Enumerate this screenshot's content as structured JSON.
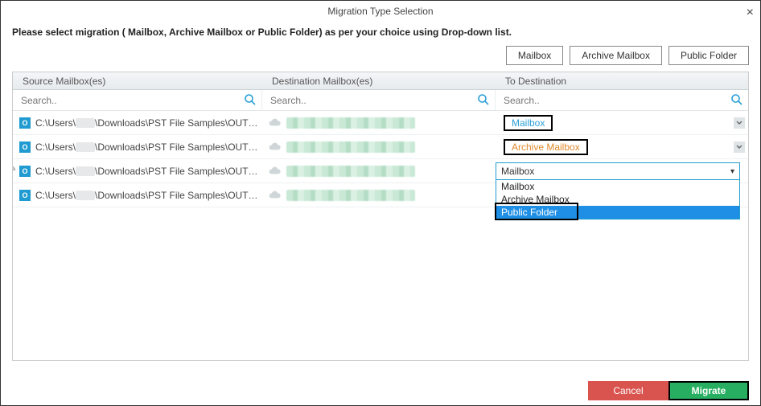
{
  "window": {
    "title": "Migration Type Selection",
    "subtitle": "Please select migration ( Mailbox, Archive Mailbox or Public Folder) as per your choice using Drop-down list."
  },
  "type_buttons": {
    "mailbox": "Mailbox",
    "archive": "Archive Mailbox",
    "public": "Public Folder"
  },
  "columns": {
    "source": "Source Mailbox(es)",
    "destination": "Destination Mailbox(es)",
    "to": "To Destination"
  },
  "search": {
    "placeholder": "Search.."
  },
  "rows": [
    {
      "prefix": "C:\\Users\\",
      "suffix": "\\Downloads\\PST File Samples\\OUTLOO...",
      "dest_label": "Mailbox",
      "dest_style": "blue"
    },
    {
      "prefix": "C:\\Users\\",
      "suffix": "\\Downloads\\PST File Samples\\OUTLOO...",
      "dest_label": "Archive Mailbox",
      "dest_style": "orange"
    },
    {
      "prefix": "C:\\Users\\",
      "suffix": "\\Downloads\\PST File Samples\\OUTLOO...",
      "dest_label": "Mailbox",
      "dest_style": "open"
    },
    {
      "prefix": "C:\\Users\\",
      "suffix": "\\Downloads\\PST File Samples\\OUTLOO...",
      "dest_label": "",
      "dest_style": "none"
    }
  ],
  "dropdown": {
    "selected": "Mailbox",
    "options": [
      "Mailbox",
      "Archive Mailbox",
      "Public Folder"
    ],
    "highlighted": "Public Folder"
  },
  "footer": {
    "cancel": "Cancel",
    "migrate": "Migrate"
  }
}
